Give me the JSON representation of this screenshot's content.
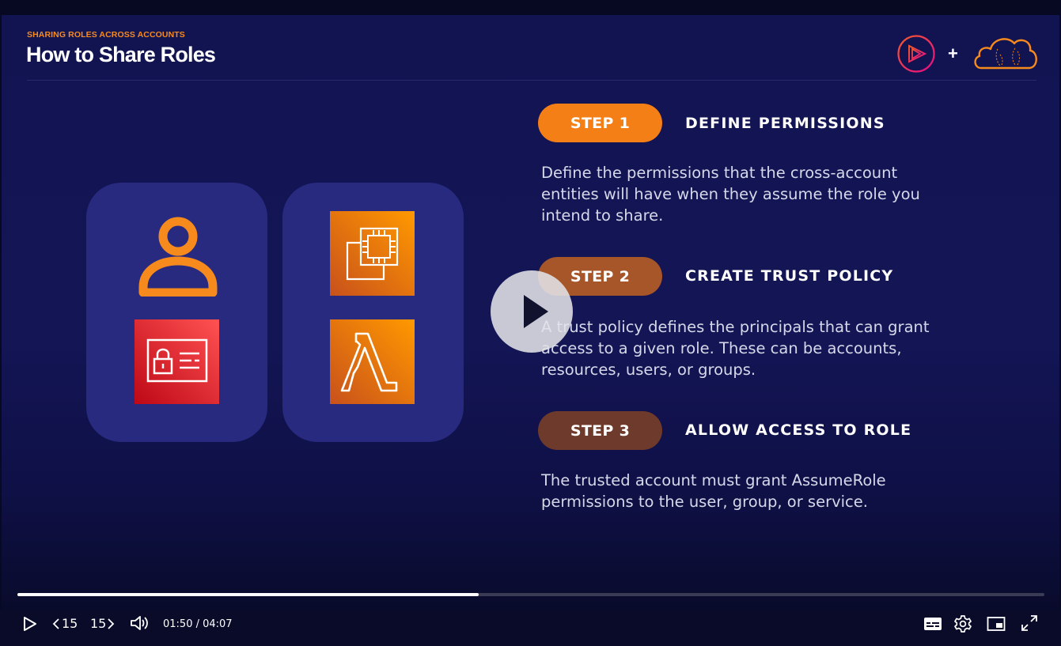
{
  "slide": {
    "kicker": "SHARING ROLES ACROSS ACCOUNTS",
    "title": "How to Share Roles",
    "logo_plus": "+",
    "steps": [
      {
        "pill": "STEP 1",
        "heading": "DEFINE PERMISSIONS",
        "text": "Define the permissions that the cross-account entities will have when they assume the role you intend to share.",
        "color": "#f47f17"
      },
      {
        "pill": "STEP 2",
        "heading": "CREATE TRUST POLICY",
        "text": "A trust policy defines the principals that can grant access to a given role. These can be accounts, resources, users, or groups.",
        "color": "#a65628"
      },
      {
        "pill": "STEP 3",
        "heading": "ALLOW ACCESS TO ROLE",
        "text": "The trusted account must grant AssumeRole permissions to the user, group, or service.",
        "color": "#6e3a2b"
      }
    ],
    "icons": [
      "user-icon",
      "id-card-lock-icon",
      "ec2-chip-icon",
      "lambda-icon"
    ],
    "colors": {
      "accent": "#f78a1d",
      "background": "#131555",
      "card": "#272a7e"
    }
  },
  "player": {
    "progress": 0.449,
    "skip_back_label": "15",
    "skip_forward_label": "15",
    "time_display": "01:50 / 04:07",
    "icons": [
      "play-icon",
      "skip-back-icon",
      "skip-forward-icon",
      "volume-icon",
      "captions-icon",
      "settings-icon",
      "picture-in-picture-icon",
      "fullscreen-icon"
    ]
  }
}
